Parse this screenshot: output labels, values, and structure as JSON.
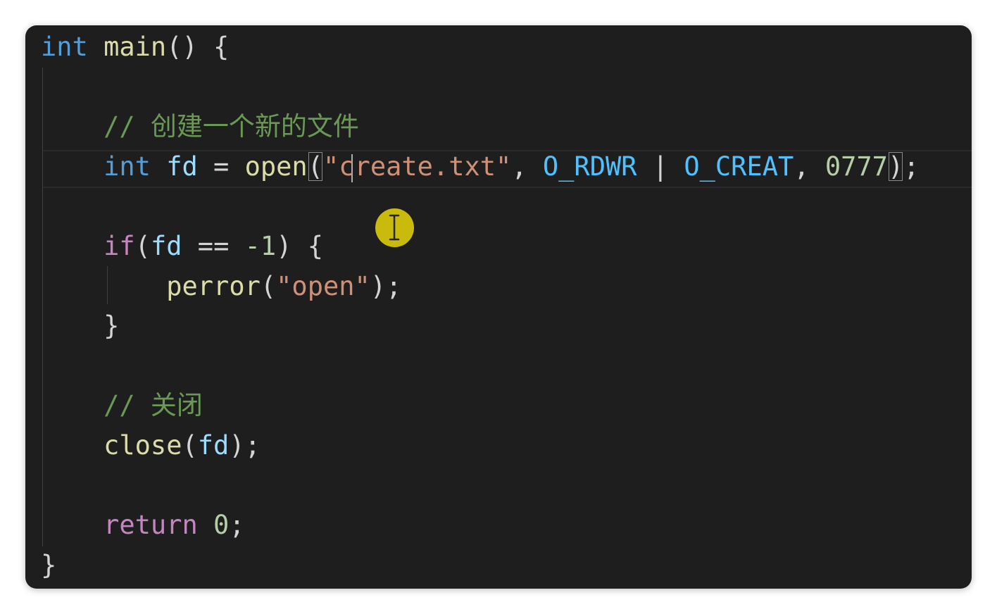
{
  "code_lines": [
    [
      {
        "t": "int",
        "c": "kw"
      },
      {
        "t": " ",
        "c": "pun"
      },
      {
        "t": "main",
        "c": "fn"
      },
      {
        "t": "() {",
        "c": "pun"
      }
    ],
    [],
    [
      {
        "t": "    // 创建一个新的文件",
        "c": "cmt"
      }
    ],
    [
      {
        "t": "    ",
        "c": "pun"
      },
      {
        "t": "int",
        "c": "kw"
      },
      {
        "t": " ",
        "c": "pun"
      },
      {
        "t": "fd",
        "c": "var"
      },
      {
        "t": " = ",
        "c": "pun"
      },
      {
        "t": "open",
        "c": "fn"
      },
      {
        "t": "(",
        "c": "pun",
        "m": true
      },
      {
        "t": "\"create.txt\"",
        "c": "str"
      },
      {
        "t": ", ",
        "c": "pun"
      },
      {
        "t": "O_RDWR",
        "c": "const"
      },
      {
        "t": " | ",
        "c": "pun"
      },
      {
        "t": "O_CREAT",
        "c": "const"
      },
      {
        "t": ", ",
        "c": "pun"
      },
      {
        "t": "0777",
        "c": "num"
      },
      {
        "t": ")",
        "c": "pun",
        "m": true
      },
      {
        "t": ";",
        "c": "pun"
      }
    ],
    [],
    [
      {
        "t": "    ",
        "c": "pun"
      },
      {
        "t": "if",
        "c": "ctl"
      },
      {
        "t": "(",
        "c": "pun"
      },
      {
        "t": "fd",
        "c": "var"
      },
      {
        "t": " == ",
        "c": "pun"
      },
      {
        "t": "-1",
        "c": "num"
      },
      {
        "t": ") {",
        "c": "pun"
      }
    ],
    [
      {
        "t": "        ",
        "c": "pun"
      },
      {
        "t": "perror",
        "c": "fn"
      },
      {
        "t": "(",
        "c": "pun"
      },
      {
        "t": "\"open\"",
        "c": "str"
      },
      {
        "t": ");",
        "c": "pun"
      }
    ],
    [
      {
        "t": "    }",
        "c": "pun"
      }
    ],
    [],
    [
      {
        "t": "    // 关闭",
        "c": "cmt"
      }
    ],
    [
      {
        "t": "    ",
        "c": "pun"
      },
      {
        "t": "close",
        "c": "fn"
      },
      {
        "t": "(",
        "c": "pun"
      },
      {
        "t": "fd",
        "c": "var"
      },
      {
        "t": ");",
        "c": "pun"
      }
    ],
    [],
    [
      {
        "t": "    ",
        "c": "pun"
      },
      {
        "t": "return",
        "c": "ctl"
      },
      {
        "t": " ",
        "c": "pun"
      },
      {
        "t": "0",
        "c": "num"
      },
      {
        "t": ";",
        "c": "pun"
      }
    ],
    [
      {
        "t": "}",
        "c": "pun"
      }
    ]
  ],
  "icons": {
    "mouse_pointer": "text-ibeam-cursor-icon"
  },
  "colors": {
    "background": "#1e1e1e",
    "keyword": "#569cd6",
    "control": "#c586c0",
    "function": "#dcdcaa",
    "variable": "#9cdcfe",
    "constant": "#4fc1ff",
    "string": "#ce9178",
    "number": "#b5cea8",
    "comment": "#6a9955",
    "pointer_highlight": "#d4c30a"
  }
}
